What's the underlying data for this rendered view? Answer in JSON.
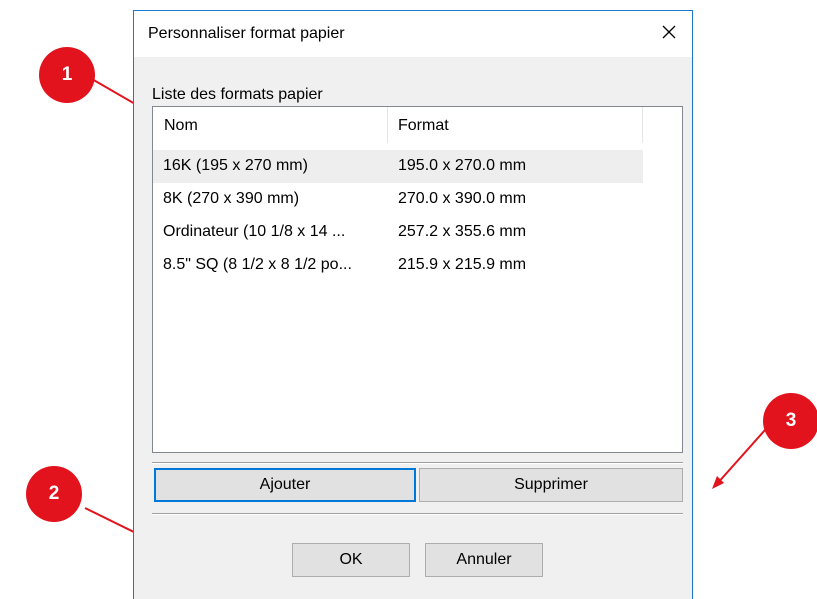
{
  "dialog": {
    "title": "Personnaliser format papier",
    "list_label": "Liste des formats papier",
    "columns": [
      "Nom",
      "Format"
    ],
    "rows": [
      {
        "name": "16K (195 x 270 mm)",
        "format": "195.0 x 270.0 mm",
        "selected": true
      },
      {
        "name": "8K (270 x 390 mm)",
        "format": "270.0 x 390.0 mm"
      },
      {
        "name": "Ordinateur (10 1/8 x 14 ...",
        "format": "257.2 x 355.6 mm"
      },
      {
        "name": "8.5\" SQ (8 1/2 x 8 1/2 po...",
        "format": "215.9 x 215.9 mm"
      }
    ],
    "buttons": {
      "add": "Ajouter",
      "delete": "Supprimer",
      "ok": "OK",
      "cancel": "Annuler"
    }
  },
  "callouts": [
    "1",
    "2",
    "3"
  ],
  "colors": {
    "callout": "#e3131e",
    "accent_border": "#0078d7",
    "window_border": "#1979ca"
  },
  "icons": {
    "close": "close-icon"
  }
}
